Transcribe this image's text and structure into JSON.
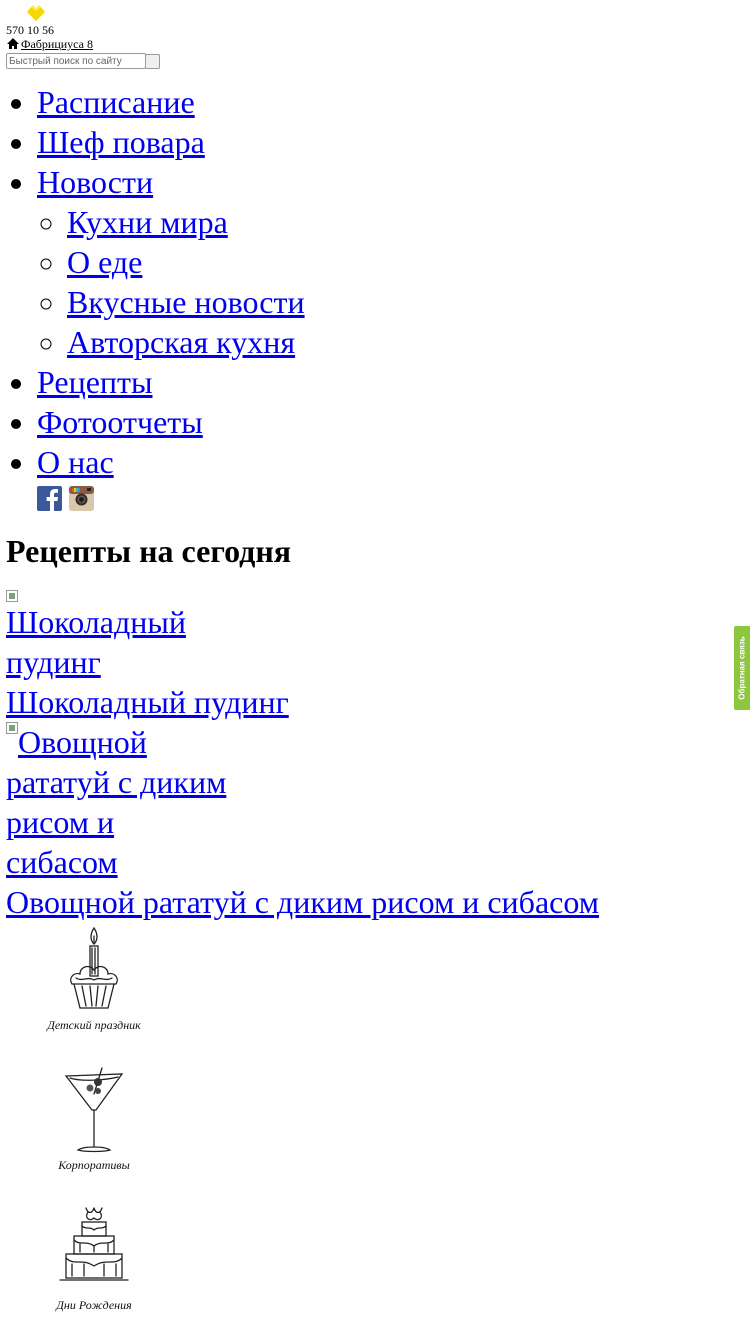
{
  "header": {
    "phone": "570 10 56",
    "address": "Фабрициуса 8",
    "search_placeholder": "Быстрый поиск по сайту",
    "logo_icon": "yellow-diamond-logo-icon",
    "home_icon": "home-icon",
    "accent_color": "#f5d800"
  },
  "nav": {
    "items": [
      {
        "label": "Расписание"
      },
      {
        "label": "Шеф повара"
      },
      {
        "label": "Новости",
        "children": [
          {
            "label": "Кухни мира"
          },
          {
            "label": "О еде"
          },
          {
            "label": "Вкусные новости"
          },
          {
            "label": "Авторская кухня"
          }
        ]
      },
      {
        "label": "Рецепты"
      },
      {
        "label": "Фотоотчеты"
      },
      {
        "label": "О нас"
      }
    ],
    "social": [
      {
        "icon": "facebook-icon",
        "color": "#3b5998"
      },
      {
        "icon": "instagram-icon",
        "color": "#8a5a44"
      }
    ]
  },
  "recipes_section": {
    "title": "Рецепты на сегодня",
    "items": [
      {
        "image_alt_lines": [
          "Шоколадный",
          "пудинг"
        ],
        "name": "Шоколадный пудинг"
      },
      {
        "image_alt_lines": [
          "Овощной",
          "рататуй с диким",
          "рисом и",
          "сибасом"
        ],
        "name": "Овощной рататуй с диким рисом и сибасом"
      }
    ]
  },
  "occasions": [
    {
      "caption": "Детский праздник",
      "icon": "cupcake-candle-icon"
    },
    {
      "caption": "Корпоративы",
      "icon": "cocktail-glass-icon"
    },
    {
      "caption": "Дни Рождения",
      "icon": "birthday-cake-icon"
    }
  ],
  "feedback_tab": {
    "label": "Обратная связь",
    "color": "#8dc63f"
  }
}
